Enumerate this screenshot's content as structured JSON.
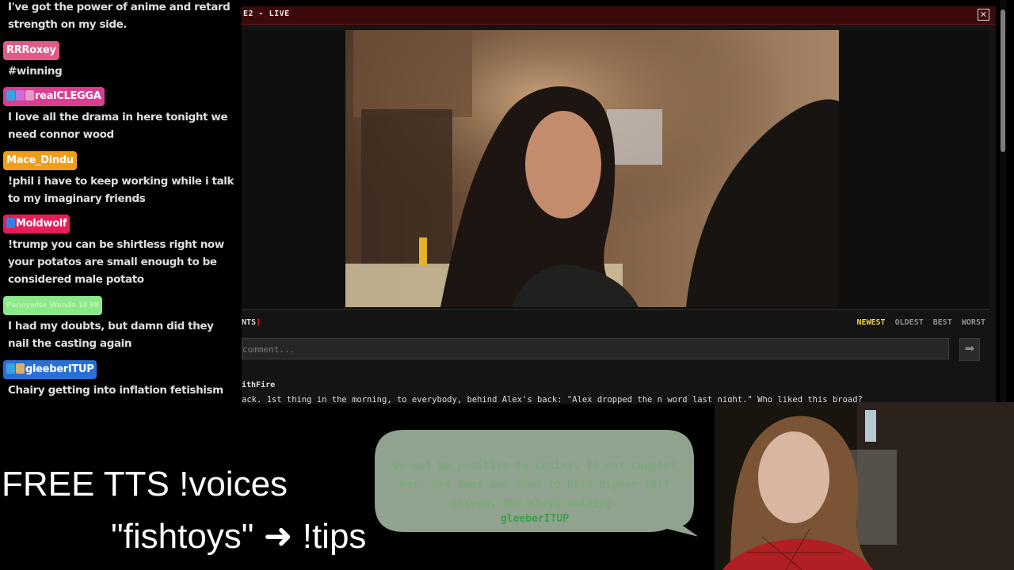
{
  "chat": {
    "messages": [
      {
        "user": "",
        "text": "I've got the power of anime and retard strength on my side.",
        "color": "#000000"
      },
      {
        "user": "RRRoxey",
        "text": "#winning",
        "color": "#e35a86"
      },
      {
        "user": "realCLEGGA",
        "text": "I love all the drama in here tonight we need connor wood",
        "color": "#d93e93"
      },
      {
        "user": "Mace_Dindu",
        "text": "!phil i have to keep working while i talk to my imaginary friends",
        "color": "#ef9d1c"
      },
      {
        "user": "Moldwolf",
        "text": "!trump you can be shirtless right now your potatos are small enough to be considered male potato",
        "color": "#e51e58"
      },
      {
        "user": "Pennywise Wande 18 88",
        "text": "I had my doubts, but damn did they nail the casting again",
        "color": "#8ce88a"
      },
      {
        "user": "gleeberITUP",
        "text": "Chairy getting into inflation fetishism",
        "color": "#2a6fd6"
      }
    ]
  },
  "window": {
    "title": "E2 - LIVE",
    "close_glyph": "✕",
    "comments_label": "NTS",
    "comments_bracket": "]",
    "sort_tabs": [
      "NEWEST",
      "OLDEST",
      "BEST",
      "WORST"
    ],
    "active_sort": "NEWEST",
    "comment_placeholder": "comment...",
    "submit_glyph": "➡",
    "comment": {
      "author": "ithFire",
      "body": "ack. 1st thing in the morning, to everybody, behind Alex's back: \"Alex dropped the n word last night.\" Who liked this broad?"
    }
  },
  "overlay": {
    "tts_line": "FREE TTS !voices",
    "tips_line": "\"fishtoys\" ➜ !tips",
    "speech_text": "Do not be positive to chairy, to not support her. She does not need to have higher self esteem. She slays nothing.",
    "speech_user": "gleeberITUP"
  },
  "colors": {
    "title_bar": "#3b0a0a",
    "active_sort": "#f0d24a",
    "speech_bubble": "#a9bfa8"
  }
}
